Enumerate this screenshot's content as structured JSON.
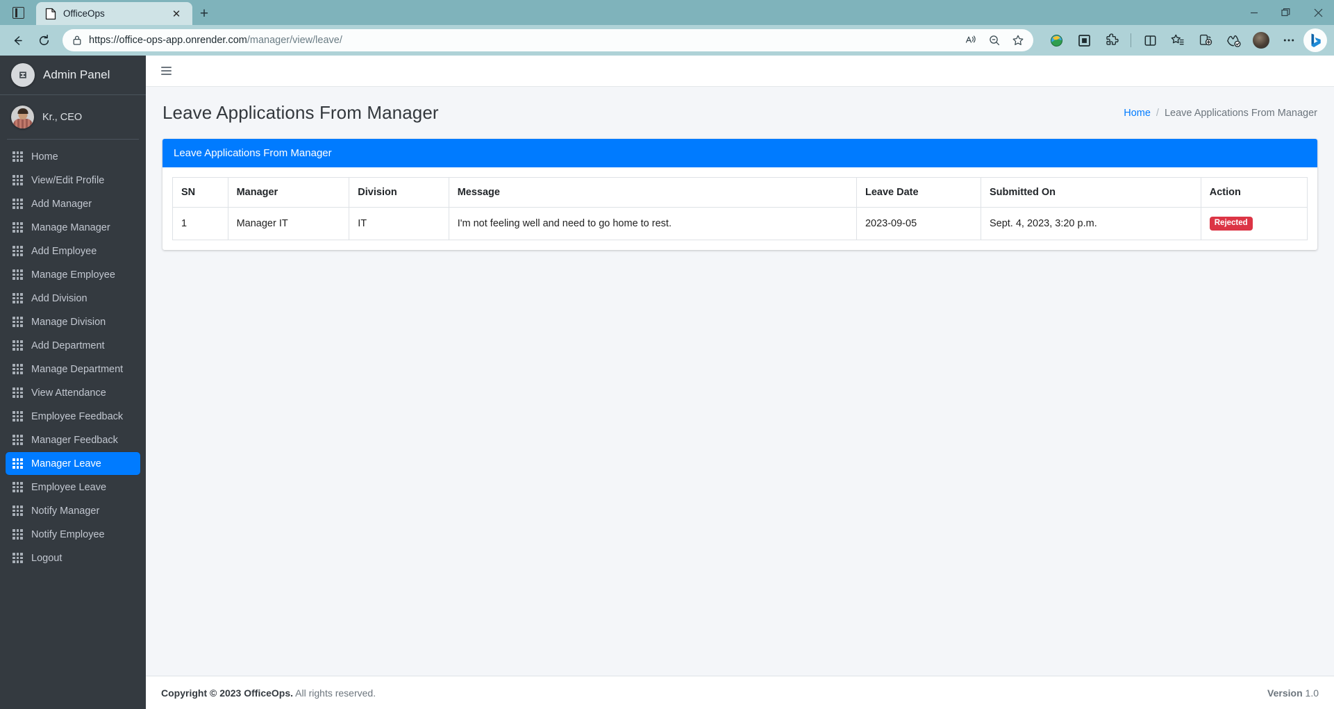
{
  "browser": {
    "tab": {
      "title": "OfficeOps",
      "favicon": "page-icon",
      "close": "✕"
    },
    "new_tab": "+",
    "url_main": "https://office-ops-app.onrender.com",
    "url_path": "/manager/view/leave/",
    "window_controls": {
      "minimize": "—",
      "restore": "❐",
      "close": "✕"
    },
    "icons": {
      "sidebar_toggle": "browser-sidebar-toggle-icon",
      "back": "back-arrow-icon",
      "reload": "reload-icon",
      "lock": "lock-icon",
      "read_aloud": "read-aloud-icon",
      "zoom": "zoom-out-icon",
      "favorite": "favorite-star-icon",
      "extension_globe": "globe-extension-icon",
      "extension_screen": "screenshot-extension-icon",
      "extension_puzzle": "extensions-puzzle-icon",
      "split_screen": "split-screen-icon",
      "collections": "collections-icon",
      "add_tab_group": "add-tab-group-icon",
      "browser_essentials": "browser-essentials-icon",
      "profile": "profile-avatar-icon",
      "settings_more": "more-settings-icon",
      "copilot": "copilot-bing-icon"
    }
  },
  "sidebar": {
    "brand": {
      "label": "Admin Panel",
      "logo": "admin-panel-logo-icon"
    },
    "user": {
      "name": "Kr., CEO",
      "avatar": "user-avatar"
    },
    "items": [
      {
        "label": "Home",
        "active": false
      },
      {
        "label": "View/Edit Profile",
        "active": false
      },
      {
        "label": "Add Manager",
        "active": false
      },
      {
        "label": "Manage Manager",
        "active": false
      },
      {
        "label": "Add Employee",
        "active": false
      },
      {
        "label": "Manage Employee",
        "active": false
      },
      {
        "label": "Add Division",
        "active": false
      },
      {
        "label": "Manage Division",
        "active": false
      },
      {
        "label": "Add Department",
        "active": false
      },
      {
        "label": "Manage Department",
        "active": false
      },
      {
        "label": "View Attendance",
        "active": false
      },
      {
        "label": "Employee Feedback",
        "active": false
      },
      {
        "label": "Manager Feedback",
        "active": false
      },
      {
        "label": "Manager Leave",
        "active": true
      },
      {
        "label": "Employee Leave",
        "active": false
      },
      {
        "label": "Notify Manager",
        "active": false
      },
      {
        "label": "Notify Employee",
        "active": false
      },
      {
        "label": "Logout",
        "active": false
      }
    ]
  },
  "topbar": {
    "menu_toggle": "hamburger-menu-icon"
  },
  "page": {
    "title": "Leave Applications From Manager",
    "breadcrumb": {
      "home": "Home",
      "separator": "/",
      "current": "Leave Applications From Manager"
    }
  },
  "card": {
    "header": "Leave Applications From Manager",
    "table": {
      "columns": [
        "SN",
        "Manager",
        "Division",
        "Message",
        "Leave Date",
        "Submitted On",
        "Action"
      ],
      "rows": [
        {
          "sn": "1",
          "manager": "Manager IT",
          "division": "IT",
          "message": "I'm not feeling well and need to go home to rest.",
          "leave_date": "2023-09-05",
          "submitted_on": "Sept. 4, 2023, 3:20 p.m.",
          "action": "Rejected"
        }
      ]
    }
  },
  "footer": {
    "copyright_strong": "Copyright © 2023 OfficeOps.",
    "copyright_rest": " All rights reserved.",
    "version_label": "Version",
    "version_value": "1.0"
  },
  "colors": {
    "accent_blue": "#007bff",
    "sidebar_dark": "#343a40",
    "danger_red": "#dc3545",
    "page_bg": "#f4f6f9",
    "chrome_teal": "#7fb3bb"
  }
}
